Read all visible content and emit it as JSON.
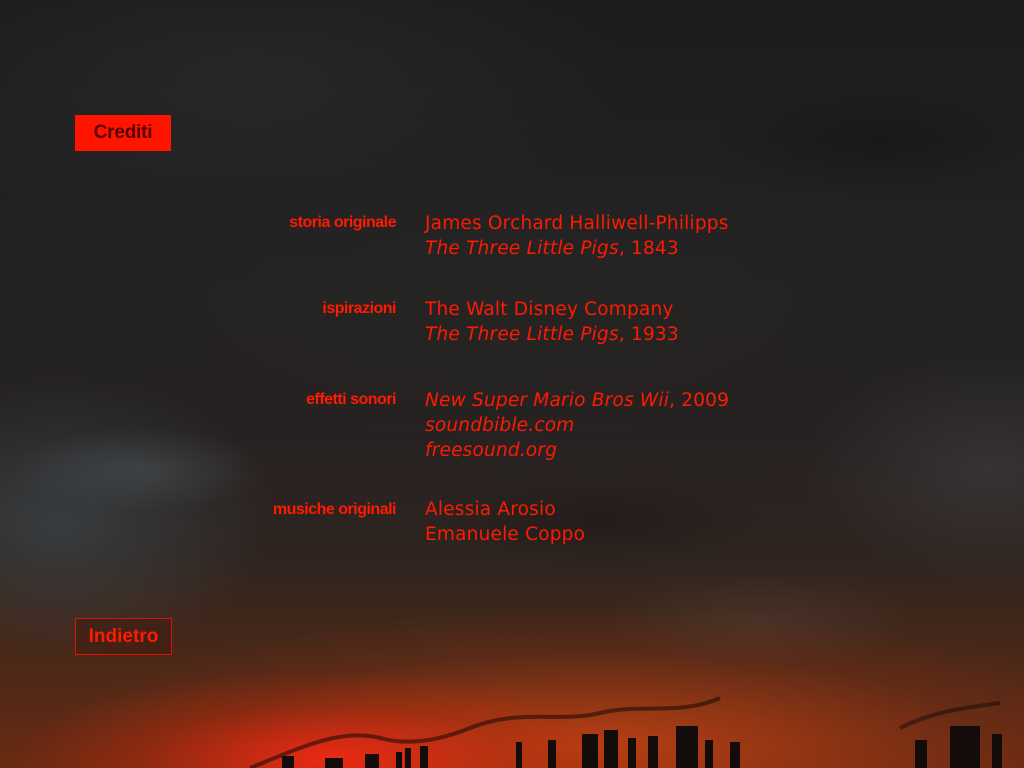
{
  "header": {
    "title": "Crediti"
  },
  "credits": {
    "story": {
      "label": "storia originale",
      "author": "James Orchard Halliwell-Philipps",
      "work_title": "The Three Little Pigs",
      "work_year": ", 1843"
    },
    "inspirations": {
      "label": "ispirazioni",
      "author": "The Walt Disney Company",
      "work_title": "The Three Little Pigs",
      "work_year": ", 1933"
    },
    "sound_effects": {
      "label": "effetti sonori",
      "game_title": "New Super Mario Bros Wii",
      "game_year": ", 2009",
      "source_1": "soundbible.com",
      "source_2": "freesound.org"
    },
    "music": {
      "label": "musiche originali",
      "composer_1": "Alessia Arosio",
      "composer_2": "Emanuele Coppo"
    }
  },
  "footer": {
    "back_label": "Indietro"
  }
}
